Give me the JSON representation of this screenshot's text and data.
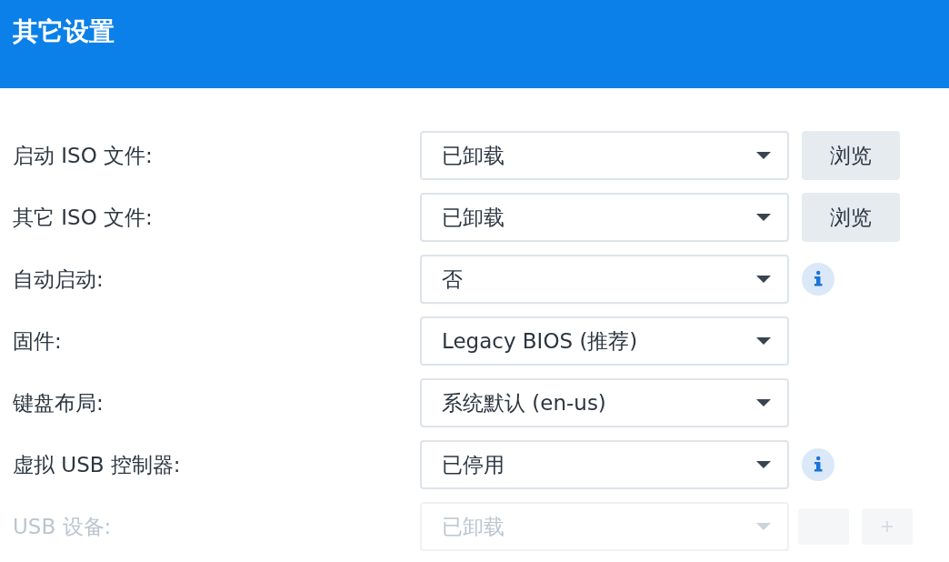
{
  "window": {
    "title": "其它设置"
  },
  "rows": [
    {
      "label": "启动 ISO 文件:",
      "value": "已卸载",
      "disabled": false,
      "kind": "browse",
      "button": "浏览"
    },
    {
      "label": "其它 ISO 文件:",
      "value": "已卸载",
      "disabled": false,
      "kind": "browse",
      "button": "浏览"
    },
    {
      "label": "自动启动:",
      "value": "否",
      "disabled": false,
      "kind": "info"
    },
    {
      "label": "固件:",
      "value": "Legacy BIOS (推荐)",
      "disabled": false,
      "kind": "plain"
    },
    {
      "label": "键盘布局:",
      "value": "系统默认 (en-us)",
      "disabled": false,
      "kind": "plain"
    },
    {
      "label": "虚拟 USB 控制器:",
      "value": "已停用",
      "disabled": false,
      "kind": "info"
    },
    {
      "label": "USB 设备:",
      "value": "已卸载",
      "disabled": true,
      "kind": "actions"
    }
  ]
}
